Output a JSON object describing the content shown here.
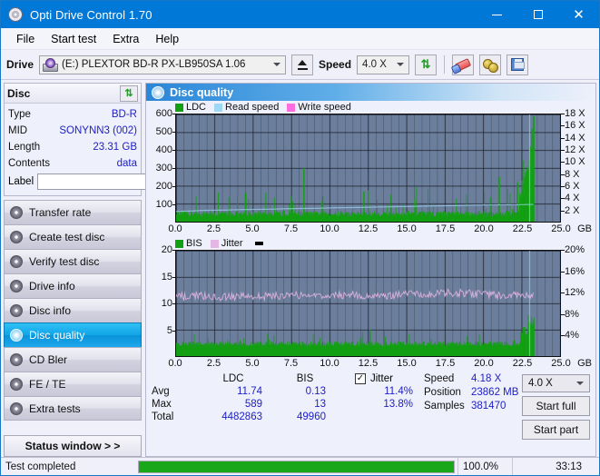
{
  "window": {
    "title": "Opti Drive Control 1.70",
    "icon": "disc-icon",
    "minimize": "–",
    "maximize": "□",
    "close": "✕"
  },
  "menu": [
    "File",
    "Start test",
    "Extra",
    "Help"
  ],
  "toolbar": {
    "drive_label": "Drive",
    "drive_value": "(E:)  PLEXTOR BD-R  PX-LB950SA 1.06",
    "eject_icon": "eject-icon",
    "speed_label": "Speed",
    "speed_value": "4.0 X",
    "refresh_icon": "refresh-icon",
    "eraser_icon": "eraser-icon",
    "brass_icon": "brass-icon",
    "save_icon": "floppy-save-icon"
  },
  "disc_panel": {
    "title": "Disc",
    "refresh_icon": "refresh-icon",
    "rows": [
      {
        "key": "Type",
        "value": "BD-R"
      },
      {
        "key": "MID",
        "value": "SONYNN3 (002)"
      },
      {
        "key": "Length",
        "value": "23.31 GB"
      },
      {
        "key": "Contents",
        "value": "data"
      }
    ],
    "label_key": "Label",
    "label_value": "",
    "label_placeholder": "",
    "disc_button_icon": "cd-disc-icon"
  },
  "sidebar": {
    "items": [
      {
        "label": "Transfer rate",
        "icon": "disc-icon",
        "active": false
      },
      {
        "label": "Create test disc",
        "icon": "disc-icon",
        "active": false
      },
      {
        "label": "Verify test disc",
        "icon": "disc-icon",
        "active": false
      },
      {
        "label": "Drive info",
        "icon": "disc-icon",
        "active": false
      },
      {
        "label": "Disc info",
        "icon": "disc-icon",
        "active": false
      },
      {
        "label": "Disc quality",
        "icon": "disc-icon",
        "active": true
      },
      {
        "label": "CD Bler",
        "icon": "disc-icon",
        "active": false
      },
      {
        "label": "FE / TE",
        "icon": "disc-icon",
        "active": false
      },
      {
        "label": "Extra tests",
        "icon": "disc-icon",
        "active": false
      }
    ],
    "status_window": "Status window > >"
  },
  "main": {
    "title": "Disc quality",
    "icon": "disc-icon"
  },
  "stats": {
    "col_headers": [
      "LDC",
      "BIS"
    ],
    "rows": [
      {
        "key": "Avg",
        "ldc": "11.74",
        "bis": "0.13",
        "jitter": "11.4%"
      },
      {
        "key": "Max",
        "ldc": "589",
        "bis": "13",
        "jitter": "13.8%"
      },
      {
        "key": "Total",
        "ldc": "4482863",
        "bis": "49960",
        "jitter": ""
      }
    ],
    "jitter_label": "Jitter",
    "jitter_checked": true,
    "jitter_check_glyph": "✓",
    "speed_label": "Speed",
    "speed_value": "4.18 X",
    "position_label": "Position",
    "position_value": "23862 MB",
    "samples_label": "Samples",
    "samples_value": "381470",
    "speed_select": "4.0 X",
    "start_full": "Start full",
    "start_part": "Start part"
  },
  "statusbar": {
    "message": "Test completed",
    "percent_label": "100.0%",
    "percent_value": 100,
    "elapsed": "33:13"
  },
  "chart_data": [
    {
      "id": "top",
      "type": "area",
      "title": "",
      "legend": [
        {
          "label": "LDC",
          "color": "#12a012"
        },
        {
          "label": "Read speed",
          "color": "#9fd8f5"
        },
        {
          "label": "Write speed",
          "color": "#ff6ee0"
        }
      ],
      "legend_position": "top-left",
      "xlabel": "GB",
      "xlim": [
        0,
        25
      ],
      "xticks": [
        "0.0",
        "2.5",
        "5.0",
        "7.5",
        "10.0",
        "12.5",
        "15.0",
        "17.5",
        "20.0",
        "22.5",
        "25.0"
      ],
      "ylabel": "",
      "ylim": [
        0,
        600
      ],
      "yticks": [
        100,
        200,
        300,
        400,
        500,
        600
      ],
      "y2label": "",
      "y2lim": [
        0,
        18
      ],
      "y2ticks": [
        "2 X",
        "4 X",
        "6 X",
        "8 X",
        "10 X",
        "12 X",
        "14 X",
        "16 X",
        "18 X"
      ],
      "grid": true,
      "series": [
        {
          "name": "LDC",
          "color": "#12a012",
          "kind": "bars",
          "baseline_avg": 11.74,
          "baseline_noise": 22,
          "values_x": [
            0.0,
            0.6,
            1.4,
            2.2,
            3.1,
            3.9,
            4.5,
            5.4,
            6.2,
            7.0,
            7.8,
            8.3,
            9.1,
            9.9,
            10.7,
            11.5,
            12.2,
            12.9,
            13.6,
            14.4,
            15.1,
            15.9,
            16.7,
            17.4,
            18.2,
            19.0,
            19.7,
            20.4,
            21.0,
            21.5,
            21.9,
            22.2,
            22.45,
            22.6,
            22.75,
            22.9,
            23.05,
            23.15,
            23.25,
            23.31
          ],
          "values_y": [
            40,
            55,
            45,
            60,
            52,
            48,
            160,
            58,
            50,
            62,
            45,
            300,
            55,
            48,
            60,
            52,
            170,
            58,
            50,
            46,
            62,
            55,
            48,
            58,
            52,
            50,
            60,
            55,
            250,
            60,
            70,
            220,
            90,
            150,
            260,
            300,
            420,
            520,
            589,
            300
          ]
        },
        {
          "name": "Read speed",
          "color": "#9fd8f5",
          "kind": "line",
          "axis": "right",
          "values_x": [
            0.0,
            2.0,
            4.0,
            6.0,
            8.0,
            10.0,
            12.0,
            14.0,
            16.0,
            18.0,
            20.0,
            22.0,
            23.31
          ],
          "values_y": [
            1.7,
            1.9,
            2.0,
            2.1,
            2.2,
            2.3,
            2.4,
            2.5,
            2.6,
            2.7,
            2.8,
            2.85,
            2.9
          ]
        },
        {
          "name": "Write speed",
          "color": "#ff6ee0",
          "kind": "line",
          "axis": "right",
          "values_x": [],
          "values_y": []
        }
      ]
    },
    {
      "id": "bottom",
      "type": "area",
      "title": "",
      "legend": [
        {
          "label": "BIS",
          "color": "#12a012"
        },
        {
          "label": "Jitter",
          "color": "#e3b6e3"
        }
      ],
      "legend_position": "top-left",
      "xlabel": "GB",
      "xlim": [
        0,
        25
      ],
      "xticks": [
        "0.0",
        "2.5",
        "5.0",
        "7.5",
        "10.0",
        "12.5",
        "15.0",
        "17.5",
        "20.0",
        "22.5",
        "25.0"
      ],
      "ylabel": "",
      "ylim": [
        0,
        20
      ],
      "yticks": [
        5,
        10,
        15,
        20
      ],
      "y2label": "",
      "y2lim": [
        0,
        20
      ],
      "y2ticks": [
        "4%",
        "8%",
        "12%",
        "16%",
        "20%"
      ],
      "grid": true,
      "series": [
        {
          "name": "BIS",
          "color": "#12a012",
          "kind": "bars",
          "baseline_avg": 0.13,
          "max": 13,
          "values_x": [
            0.0,
            1.0,
            2.0,
            3.0,
            4.0,
            5.0,
            6.0,
            7.0,
            8.0,
            9.0,
            10.0,
            11.0,
            12.0,
            12.6,
            13.0,
            14.0,
            15.0,
            16.0,
            17.0,
            18.0,
            19.0,
            20.0,
            21.0,
            22.0,
            22.6,
            23.0,
            23.31
          ],
          "values_y": [
            2.0,
            2.2,
            2.0,
            2.4,
            2.1,
            2.3,
            3.2,
            2.2,
            2.0,
            2.5,
            2.1,
            2.8,
            3.4,
            5.0,
            2.6,
            2.2,
            2.5,
            2.3,
            2.1,
            2.6,
            2.4,
            2.2,
            2.8,
            3.0,
            5.5,
            6.5,
            3.0
          ]
        },
        {
          "name": "Jitter",
          "color": "#e3b6e3",
          "kind": "line",
          "axis": "right",
          "avg": 11.4,
          "max": 13.8,
          "values_x": [
            0.0,
            1.5,
            3.0,
            4.5,
            6.0,
            7.5,
            9.0,
            10.5,
            12.0,
            13.5,
            15.0,
            16.5,
            18.0,
            19.5,
            21.0,
            22.0,
            23.31
          ],
          "values_y": [
            11.3,
            11.4,
            11.2,
            11.4,
            11.3,
            11.5,
            11.4,
            11.6,
            11.5,
            11.4,
            11.7,
            11.8,
            12.0,
            11.9,
            11.6,
            11.5,
            11.4
          ]
        }
      ]
    }
  ]
}
